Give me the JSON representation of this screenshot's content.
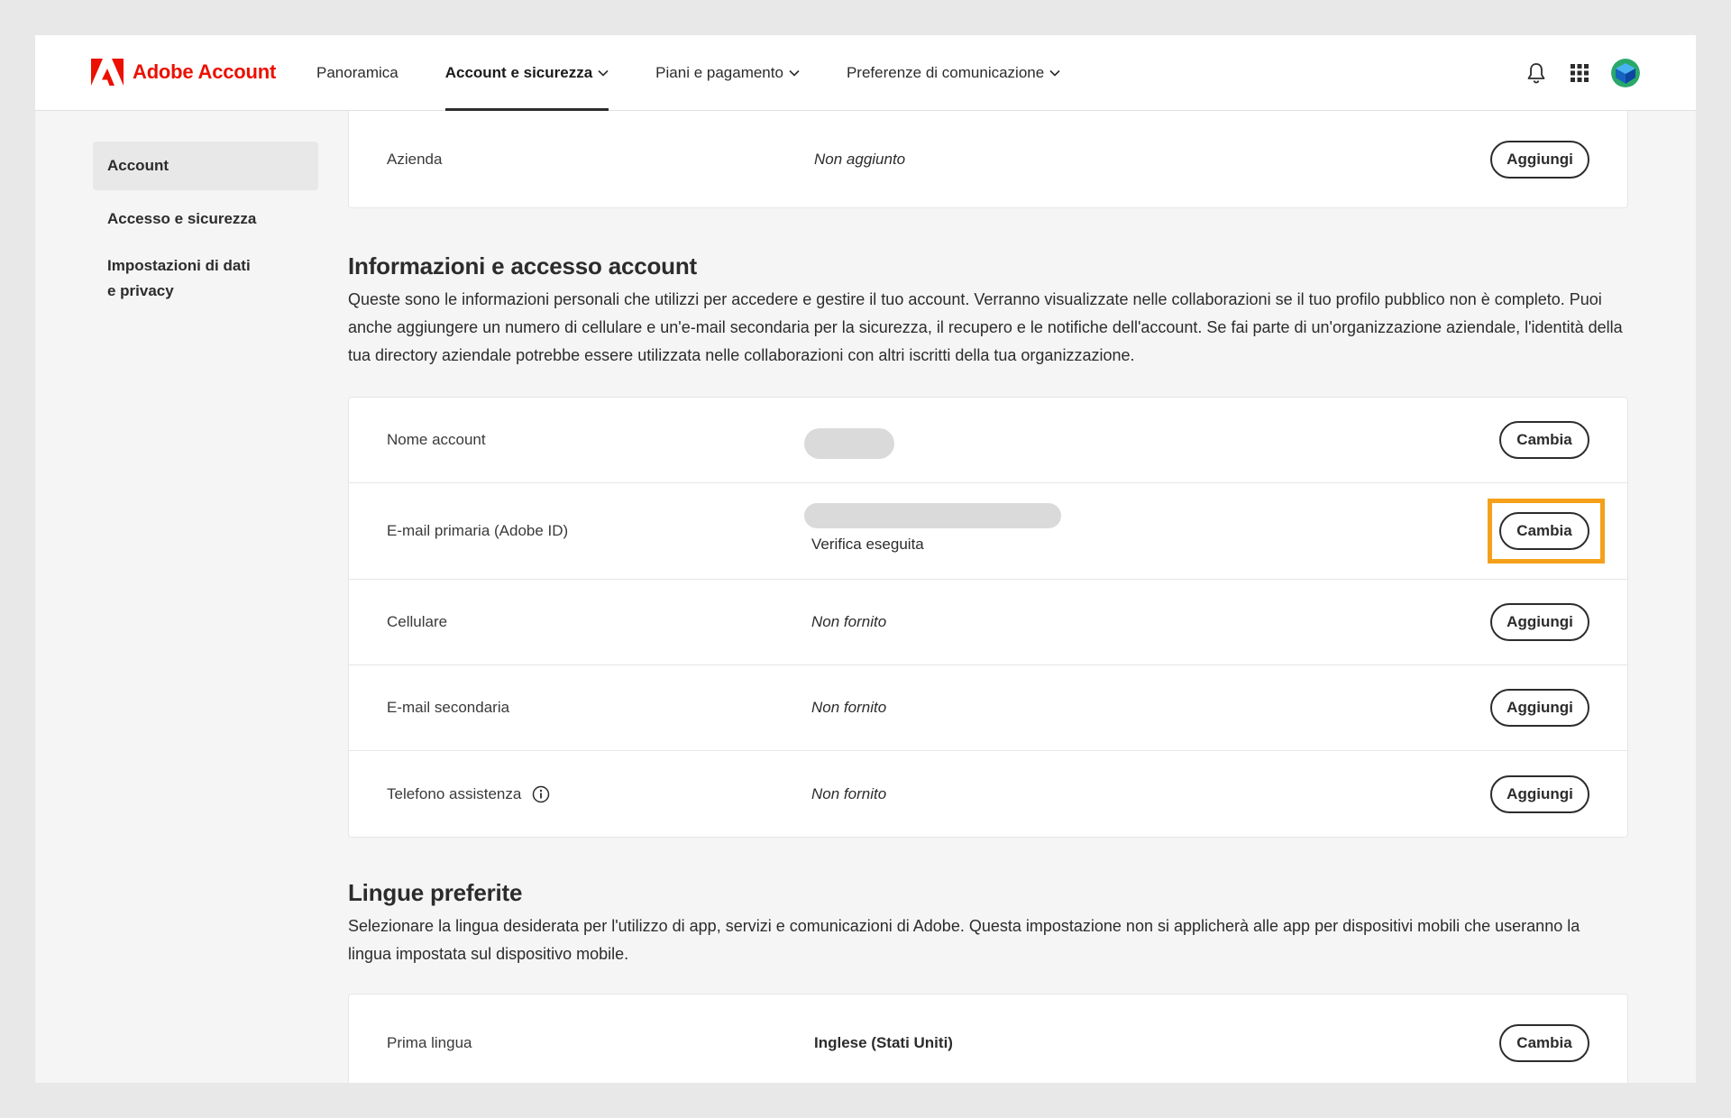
{
  "brand": {
    "name": "Adobe Account",
    "color": "#eb1000"
  },
  "nav": {
    "items": [
      {
        "label": "Panoramica",
        "active": false,
        "dropdown": false
      },
      {
        "label": "Account e sicurezza",
        "active": true,
        "dropdown": true
      },
      {
        "label": "Piani e pagamento",
        "active": false,
        "dropdown": true
      },
      {
        "label": "Preferenze di comunicazione",
        "active": false,
        "dropdown": true
      }
    ]
  },
  "header_icons": [
    "bell-icon",
    "app-grid-icon",
    "avatar"
  ],
  "sidebar": {
    "items": [
      {
        "label": "Account",
        "active": true
      },
      {
        "label": "Accesso e sicurezza",
        "active": false
      },
      {
        "label": "Impostazioni di dati e privacy",
        "active": false
      }
    ]
  },
  "company_card": {
    "label": "Azienda",
    "value": "Non aggiunto",
    "button": "Aggiungi"
  },
  "account_info": {
    "title": "Informazioni e accesso account",
    "description": "Queste sono le informazioni personali che utilizzi per accedere e gestire il tuo account. Verranno visualizzate nelle collaborazioni se il tuo profilo pubblico non è completo. Puoi anche aggiungere un numero di cellulare e un'e-mail secondaria per la sicurezza, il recupero e le notifiche dell'account. Se fai parte di un'organizzazione aziendale, l'identità della tua directory aziendale potrebbe essere utilizzata nelle collaborazioni con altri iscritti della tua organizzazione.",
    "rows": [
      {
        "label": "Nome account",
        "value": "",
        "button": "Cambia"
      },
      {
        "label": "E-mail primaria (Adobe ID)",
        "value": "",
        "status": "Verifica eseguita",
        "button": "Cambia"
      },
      {
        "label": "Cellulare",
        "value": "Non fornito",
        "button": "Aggiungi"
      },
      {
        "label": "E-mail secondaria",
        "value": "Non fornito",
        "button": "Aggiungi"
      },
      {
        "label": "Telefono assistenza",
        "value": "Non fornito",
        "button": "Aggiungi"
      }
    ]
  },
  "languages": {
    "title": "Lingue preferite",
    "description": "Selezionare la lingua desiderata per l'utilizzo di app, servizi e comunicazioni di Adobe. Questa impostazione non si applicherà alle app per dispositivi mobili che useranno la lingua impostata sul dispositivo mobile.",
    "rows": [
      {
        "label": "Prima lingua",
        "value": "Inglese (Stati Uniti)",
        "button": "Cambia"
      }
    ]
  },
  "highlight_color": "#f5a01a"
}
